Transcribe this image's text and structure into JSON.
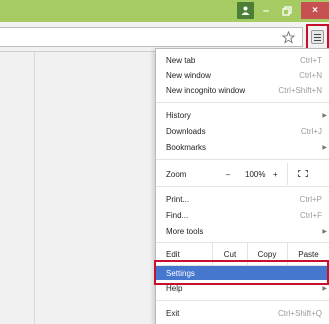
{
  "window": {
    "user_icon": "person-icon",
    "minimize": "–",
    "maximize_icon": "restore-icon",
    "close": "×"
  },
  "toolbar": {
    "star_icon": "star-icon",
    "menu_icon": "hamburger-menu-icon"
  },
  "menu": {
    "new_tab": {
      "label": "New tab",
      "shortcut": "Ctrl+T"
    },
    "new_window": {
      "label": "New window",
      "shortcut": "Ctrl+N"
    },
    "new_incognito": {
      "label": "New incognito window",
      "shortcut": "Ctrl+Shift+N"
    },
    "history": {
      "label": "History",
      "arrow": "▶"
    },
    "downloads": {
      "label": "Downloads",
      "shortcut": "Ctrl+J"
    },
    "bookmarks": {
      "label": "Bookmarks",
      "arrow": "▶"
    },
    "zoom": {
      "label": "Zoom",
      "minus": "–",
      "value": "100%",
      "plus": "+",
      "fullscreen_icon": "fullscreen-icon"
    },
    "print": {
      "label": "Print...",
      "shortcut": "Ctrl+P"
    },
    "find": {
      "label": "Find...",
      "shortcut": "Ctrl+F"
    },
    "more_tools": {
      "label": "More tools",
      "arrow": "▶"
    },
    "edit": {
      "label": "Edit",
      "cut": "Cut",
      "copy": "Copy",
      "paste": "Paste"
    },
    "settings": {
      "label": "Settings"
    },
    "help": {
      "label": "Help",
      "arrow": "▶"
    },
    "exit": {
      "label": "Exit",
      "shortcut": "Ctrl+Shift+Q"
    }
  },
  "colors": {
    "titlebar": "#a7cb63",
    "highlight": "#4677cf",
    "callout": "#c8102e",
    "close_button": "#c75050"
  }
}
